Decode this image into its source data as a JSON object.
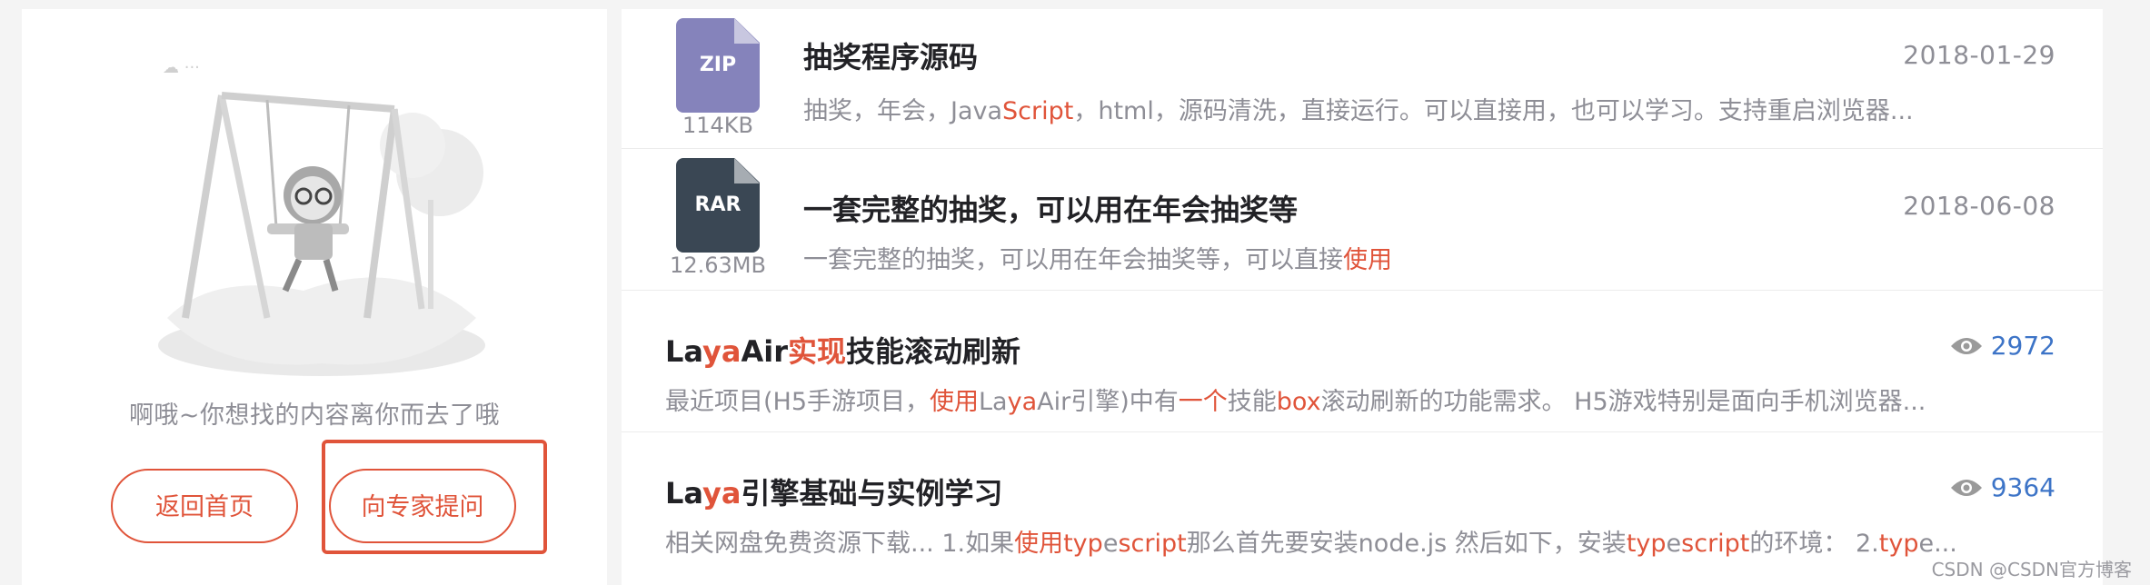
{
  "empty_state": {
    "message": "啊哦~你想找的内容离你而去了哦",
    "home_button": "返回首页",
    "ask_button": "向专家提问"
  },
  "results": [
    {
      "type": "file",
      "icon_label": "ZIP",
      "icon_color": "#8583bb",
      "size": "114KB",
      "title": "抽奖程序源码",
      "date": "2018-01-29",
      "desc_parts": [
        "抽奖，年会，Java",
        "Script",
        "，html，源码清洗，直接运行。可以直接用，也可以学习。支持重启浏览器..."
      ]
    },
    {
      "type": "file",
      "icon_label": "RAR",
      "icon_color": "#3a4754",
      "size": "12.63MB",
      "title": "一套完整的抽奖，可以用在年会抽奖等",
      "date": "2018-06-08",
      "desc_parts": [
        "一套完整的抽奖，可以用在年会抽奖等，可以直接",
        "使用",
        ""
      ]
    },
    {
      "type": "article",
      "title_parts": [
        "La",
        "ya",
        "Air",
        "实现",
        "技能滚动刷新"
      ],
      "views": "2972",
      "desc_parts": [
        "最近项目(H5手游项目，",
        "使用",
        "La",
        "ya",
        "Air引擎)中有",
        "一个",
        "技能",
        "box",
        "滚动刷新的功能需求。 H5游戏特别是面向手机浏览器..."
      ]
    },
    {
      "type": "article",
      "title_parts": [
        "La",
        "ya",
        "引擎基础与实例学习"
      ],
      "views": "9364",
      "desc_parts": [
        "相关网盘免费资源下载... 1.如果",
        "使用",
        "typ",
        "e",
        "script",
        "那么首先要安装node.js 然后如下，安装",
        "typ",
        "e",
        "script",
        "的环境： 2.",
        "typ",
        "e..."
      ]
    }
  ],
  "watermark": "CSDN @CSDN官方博客",
  "colors": {
    "accent": "#e0543a",
    "views": "#3d74c7",
    "muted": "#8e8e96"
  }
}
